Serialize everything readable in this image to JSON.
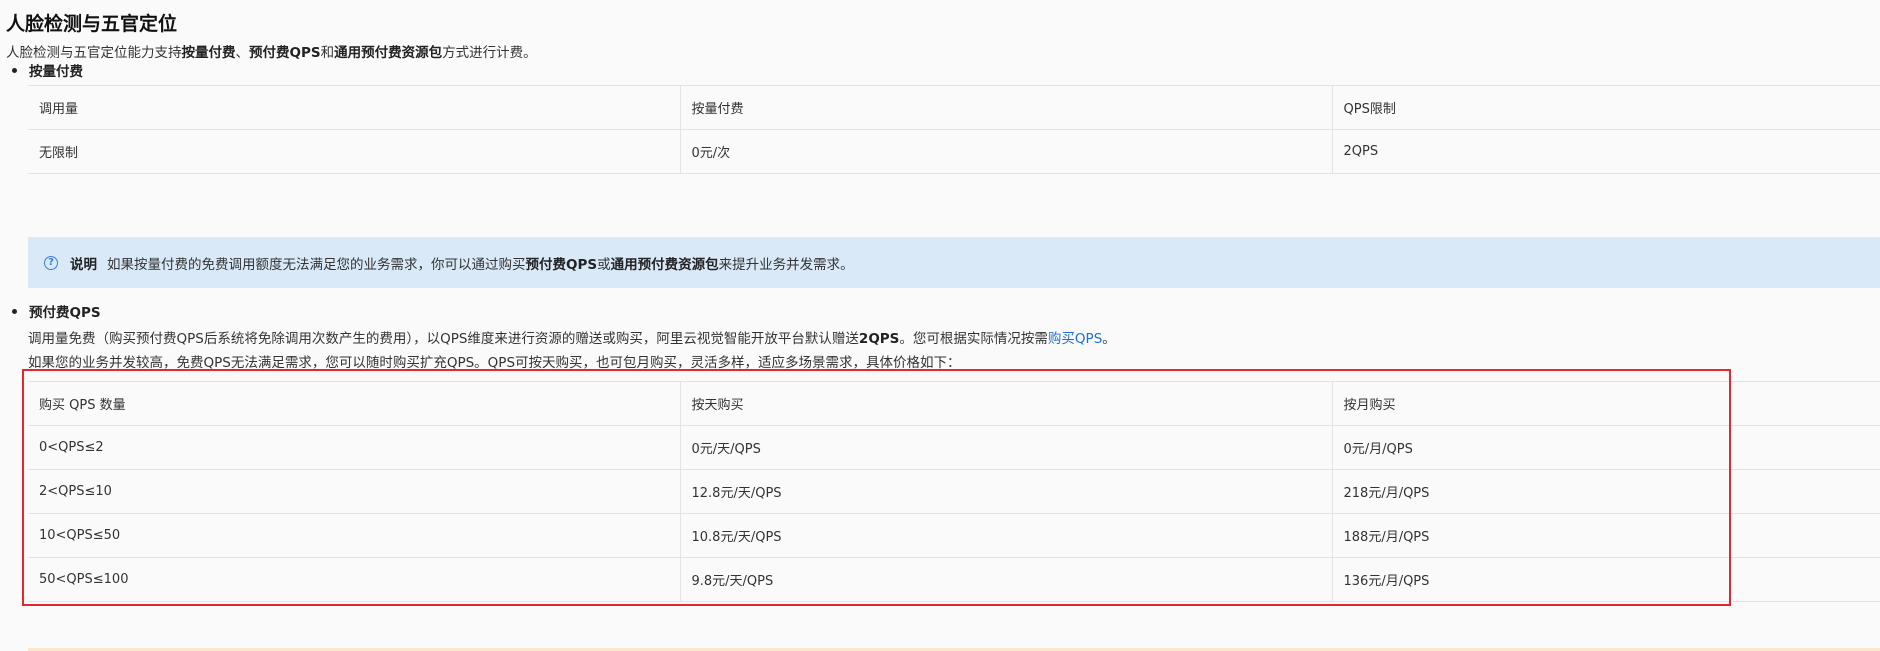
{
  "heading": "人脸检测与五官定位",
  "intro": {
    "prefix": "人脸检测与五官定位能力支持",
    "b1": "按量付费",
    "sep1": "、",
    "b2": "预付费QPS",
    "mid": "和",
    "b3": "通用预付费资源包",
    "suffix": "方式进行计费。"
  },
  "section1": {
    "title": "按量付费",
    "headers": [
      "调用量",
      "按量付费",
      "QPS限制"
    ],
    "rows": [
      [
        "无限制",
        "0元/次",
        "2QPS"
      ]
    ]
  },
  "note": {
    "icon": "question-circle-icon",
    "label": "说明",
    "prefix": "如果按量付费的免费调用额度无法满足您的业务需求，你可以通过购买",
    "b1": "预付费QPS",
    "mid": "或",
    "b2": "通用预付费资源包",
    "suffix": "来提升业务并发需求。"
  },
  "section2": {
    "title": "预付费QPS",
    "para1": {
      "prefix": "调用量免费（购买预付费QPS后系统将免除调用次数产生的费用），以QPS维度来进行资源的赠送或购买，阿里云视觉智能开放平台默认赠送",
      "bold": "2QPS",
      "mid": "。您可根据实际情况按需",
      "link": "购买QPS",
      "suffix": "。"
    },
    "para2": "如果您的业务并发较高，免费QPS无法满足需求，您可以随时购买扩充QPS。QPS可按天购买，也可包月购买，灵活多样，适应多场景需求，具体价格如下：",
    "headers": [
      "购买 QPS 数量",
      "按天购买",
      "按月购买"
    ],
    "rows": [
      [
        "0<QPS≤2",
        "0元/天/QPS",
        "0元/月/QPS"
      ],
      [
        "2<QPS≤10",
        "12.8元/天/QPS",
        "218元/月/QPS"
      ],
      [
        "10<QPS≤50",
        "10.8元/天/QPS",
        "188元/月/QPS"
      ],
      [
        "50<QPS≤100",
        "9.8元/天/QPS",
        "136元/月/QPS"
      ]
    ]
  },
  "colors": {
    "highlight_box": "#e5262b",
    "note_bg": "#d9e9f8",
    "link": "#1f6fd1"
  }
}
